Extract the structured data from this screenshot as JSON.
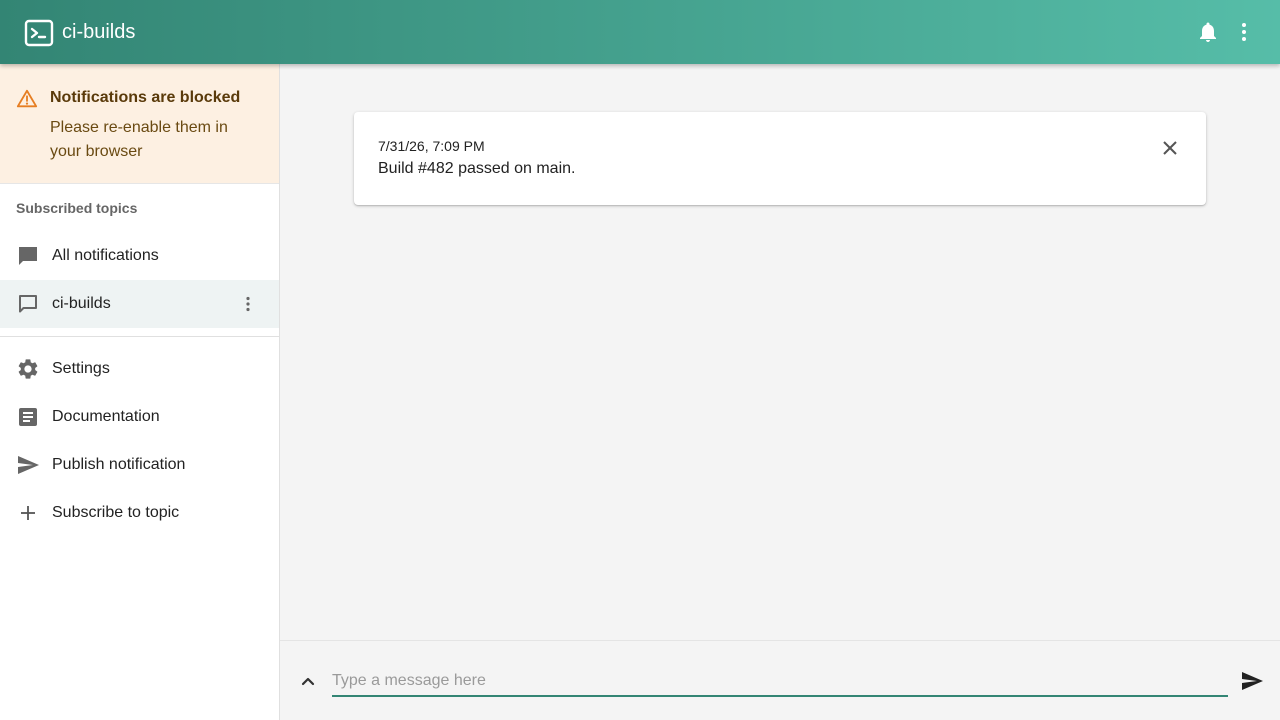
{
  "header": {
    "title": "ci-builds",
    "logo_icon": "terminal-icon",
    "actions": [
      "bell-icon",
      "more-vert-icon"
    ]
  },
  "sidebar": {
    "warning": {
      "title": "Notifications are blocked",
      "body": "Please re-enable them in your browser"
    },
    "section_label": "Subscribed topics",
    "topics": [
      {
        "label": "All notifications",
        "icon": "chat-filled-icon"
      },
      {
        "label": "ci-builds",
        "icon": "chat-outline-icon",
        "active": true
      }
    ],
    "menu": [
      {
        "label": "Settings",
        "icon": "gear-icon"
      },
      {
        "label": "Documentation",
        "icon": "document-icon"
      },
      {
        "label": "Publish notification",
        "icon": "send-icon"
      },
      {
        "label": "Subscribe to topic",
        "icon": "plus-icon"
      }
    ]
  },
  "main": {
    "notification": {
      "time": "7/31/26, 7:09 PM",
      "message": "Build #482 passed on main."
    }
  },
  "composer": {
    "placeholder": "Type a message here",
    "value": ""
  },
  "colors": {
    "accent": "#338574",
    "accent_light": "#56bda8",
    "warning_bg": "#fdf0e2",
    "warning_icon": "#e67e22"
  }
}
